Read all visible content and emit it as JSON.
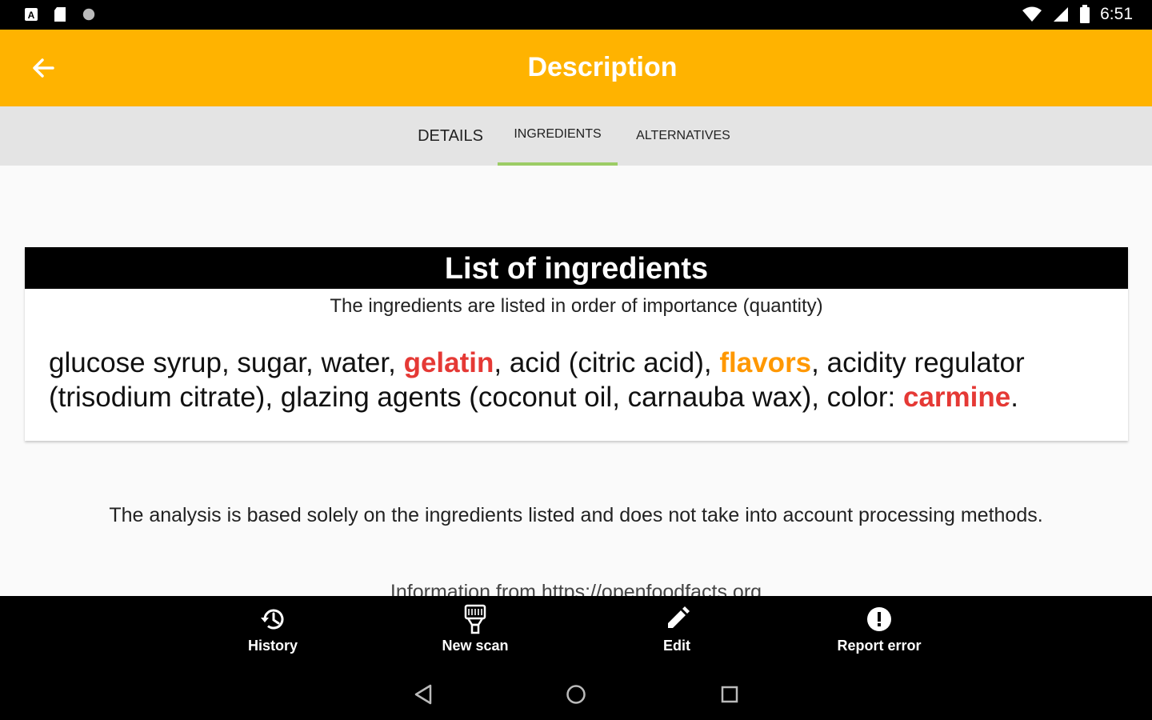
{
  "status_bar": {
    "left_icons": [
      "notification-a-icon",
      "sd-card-icon",
      "circle-icon"
    ],
    "right_icons": [
      "wifi-icon",
      "signal-icon",
      "battery-icon"
    ],
    "time": "6:51"
  },
  "app_bar": {
    "title": "Description",
    "back_icon": "arrow-back-icon",
    "color": "#ffb300"
  },
  "tabs": [
    {
      "label": "DETAILS",
      "selected": false
    },
    {
      "label": "INGREDIENTS",
      "selected": true
    },
    {
      "label": "ALTERNATIVES",
      "selected": false
    }
  ],
  "ingredients_card": {
    "title": "List of ingredients",
    "subtitle": "The ingredients are listed in order of importance (quantity)",
    "segments": [
      {
        "text": "glucose syrup, sugar, water, ",
        "style": "normal"
      },
      {
        "text": "gelatin",
        "style": "allergen"
      },
      {
        "text": ", acid (citric acid), ",
        "style": "normal"
      },
      {
        "text": "flavors",
        "style": "additive"
      },
      {
        "text": ", acidity regulator (trisodium citrate), glazing agents (coconut oil, carnauba wax), color: ",
        "style": "normal"
      },
      {
        "text": "carmine",
        "style": "allergen"
      },
      {
        "text": ".",
        "style": "normal"
      }
    ],
    "colors": {
      "allergen": "#e53935",
      "additive": "#ff9800"
    }
  },
  "analysis_note": "The analysis is based solely on the ingredients listed and does not take into account processing methods.",
  "source_note": "Information from https://openfoodfacts.org",
  "bottom_nav": [
    {
      "label": "History",
      "icon": "history-icon"
    },
    {
      "label": "New scan",
      "icon": "barcode-scanner-icon"
    },
    {
      "label": "Edit",
      "icon": "pencil-icon"
    },
    {
      "label": "Report error",
      "icon": "alert-circle-icon"
    }
  ],
  "system_nav": [
    "back-triangle-icon",
    "home-circle-icon",
    "recents-square-icon"
  ]
}
